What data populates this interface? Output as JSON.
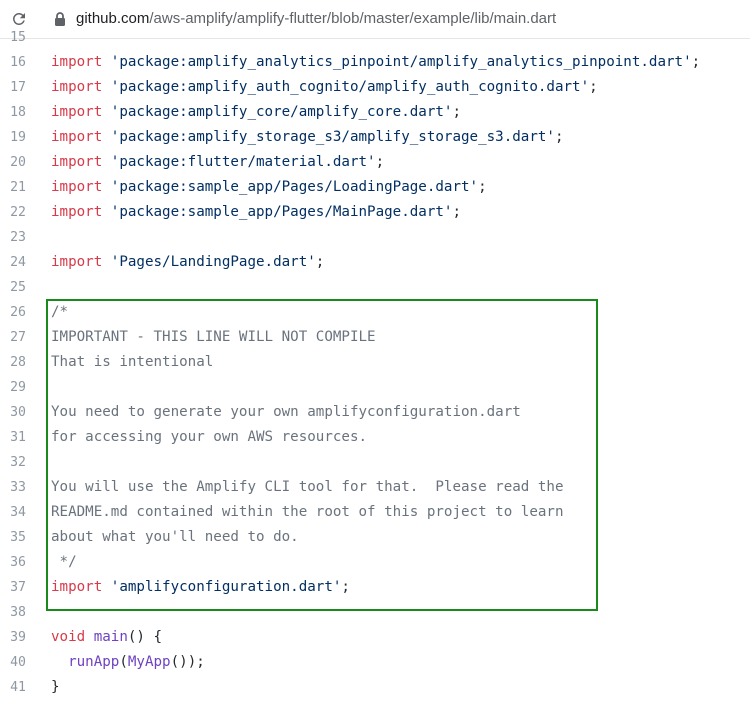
{
  "browser": {
    "url_domain": "github.com",
    "url_path": "/aws-amplify/amplify-flutter/blob/master/example/lib/main.dart"
  },
  "code_lines": [
    {
      "n": "15",
      "parts": []
    },
    {
      "n": "16",
      "parts": [
        {
          "t": "import",
          "c": "kw"
        },
        {
          "t": " ",
          "c": "pl"
        },
        {
          "t": "'package:amplify_analytics_pinpoint/amplify_analytics_pinpoint.dart'",
          "c": "str"
        },
        {
          "t": ";",
          "c": "pl"
        }
      ]
    },
    {
      "n": "17",
      "parts": [
        {
          "t": "import",
          "c": "kw"
        },
        {
          "t": " ",
          "c": "pl"
        },
        {
          "t": "'package:amplify_auth_cognito/amplify_auth_cognito.dart'",
          "c": "str"
        },
        {
          "t": ";",
          "c": "pl"
        }
      ]
    },
    {
      "n": "18",
      "parts": [
        {
          "t": "import",
          "c": "kw"
        },
        {
          "t": " ",
          "c": "pl"
        },
        {
          "t": "'package:amplify_core/amplify_core.dart'",
          "c": "str"
        },
        {
          "t": ";",
          "c": "pl"
        }
      ]
    },
    {
      "n": "19",
      "parts": [
        {
          "t": "import",
          "c": "kw"
        },
        {
          "t": " ",
          "c": "pl"
        },
        {
          "t": "'package:amplify_storage_s3/amplify_storage_s3.dart'",
          "c": "str"
        },
        {
          "t": ";",
          "c": "pl"
        }
      ]
    },
    {
      "n": "20",
      "parts": [
        {
          "t": "import",
          "c": "kw"
        },
        {
          "t": " ",
          "c": "pl"
        },
        {
          "t": "'package:flutter/material.dart'",
          "c": "str"
        },
        {
          "t": ";",
          "c": "pl"
        }
      ]
    },
    {
      "n": "21",
      "parts": [
        {
          "t": "import",
          "c": "kw"
        },
        {
          "t": " ",
          "c": "pl"
        },
        {
          "t": "'package:sample_app/Pages/LoadingPage.dart'",
          "c": "str"
        },
        {
          "t": ";",
          "c": "pl"
        }
      ]
    },
    {
      "n": "22",
      "parts": [
        {
          "t": "import",
          "c": "kw"
        },
        {
          "t": " ",
          "c": "pl"
        },
        {
          "t": "'package:sample_app/Pages/MainPage.dart'",
          "c": "str"
        },
        {
          "t": ";",
          "c": "pl"
        }
      ]
    },
    {
      "n": "23",
      "parts": []
    },
    {
      "n": "24",
      "parts": [
        {
          "t": "import",
          "c": "kw"
        },
        {
          "t": " ",
          "c": "pl"
        },
        {
          "t": "'Pages/LandingPage.dart'",
          "c": "str"
        },
        {
          "t": ";",
          "c": "pl"
        }
      ]
    },
    {
      "n": "25",
      "parts": []
    },
    {
      "n": "26",
      "parts": [
        {
          "t": "/*",
          "c": "cm"
        }
      ]
    },
    {
      "n": "27",
      "parts": [
        {
          "t": "IMPORTANT - THIS LINE WILL NOT COMPILE",
          "c": "cm"
        }
      ]
    },
    {
      "n": "28",
      "parts": [
        {
          "t": "That is intentional",
          "c": "cm"
        }
      ]
    },
    {
      "n": "29",
      "parts": []
    },
    {
      "n": "30",
      "parts": [
        {
          "t": "You need to generate your own amplifyconfiguration.dart",
          "c": "cm"
        }
      ]
    },
    {
      "n": "31",
      "parts": [
        {
          "t": "for accessing your own AWS resources.",
          "c": "cm"
        }
      ]
    },
    {
      "n": "32",
      "parts": []
    },
    {
      "n": "33",
      "parts": [
        {
          "t": "You will use the Amplify CLI tool for that.  Please read the",
          "c": "cm"
        }
      ]
    },
    {
      "n": "34",
      "parts": [
        {
          "t": "README.md contained within the root of this project to learn",
          "c": "cm"
        }
      ]
    },
    {
      "n": "35",
      "parts": [
        {
          "t": "about what you'll need to do.",
          "c": "cm"
        }
      ]
    },
    {
      "n": "36",
      "parts": [
        {
          "t": " */",
          "c": "cm"
        }
      ]
    },
    {
      "n": "37",
      "parts": [
        {
          "t": "import",
          "c": "kw"
        },
        {
          "t": " ",
          "c": "pl"
        },
        {
          "t": "'amplifyconfiguration.dart'",
          "c": "str"
        },
        {
          "t": ";",
          "c": "pl"
        }
      ]
    },
    {
      "n": "38",
      "parts": []
    },
    {
      "n": "39",
      "parts": [
        {
          "t": "void",
          "c": "kw"
        },
        {
          "t": " ",
          "c": "pl"
        },
        {
          "t": "main",
          "c": "fn"
        },
        {
          "t": "() {",
          "c": "pl"
        }
      ]
    },
    {
      "n": "40",
      "parts": [
        {
          "t": "  ",
          "c": "pl"
        },
        {
          "t": "runApp",
          "c": "fn"
        },
        {
          "t": "(",
          "c": "pl"
        },
        {
          "t": "MyApp",
          "c": "fn"
        },
        {
          "t": "());",
          "c": "pl"
        }
      ]
    },
    {
      "n": "41",
      "parts": [
        {
          "t": "}",
          "c": "pl"
        }
      ]
    }
  ],
  "colors": {
    "keyword": "#d73a49",
    "string": "#032f62",
    "comment": "#6a737d",
    "function": "#6f42c1",
    "highlight_border": "#1a8a1a"
  },
  "icons": {
    "reload": "reload-icon",
    "lock": "lock-icon"
  }
}
